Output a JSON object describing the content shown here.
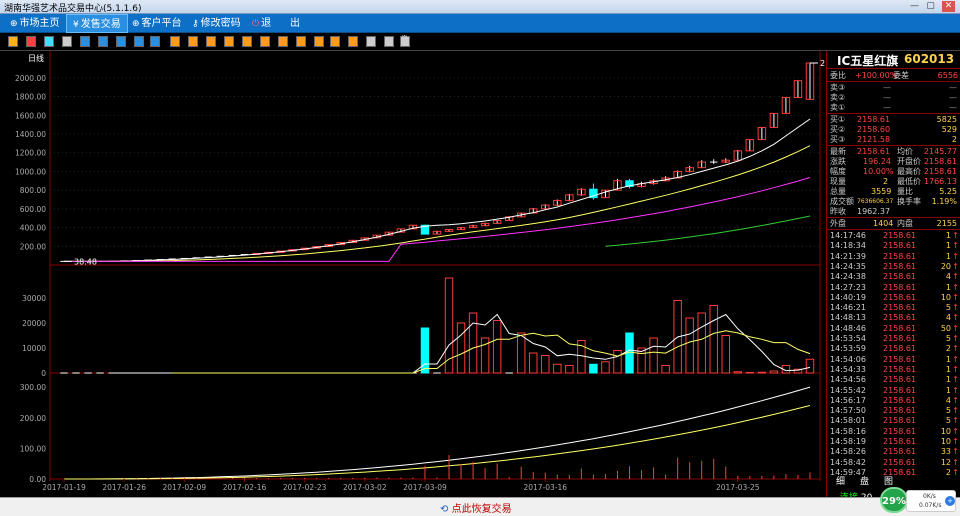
{
  "window": {
    "title": "湖南华强艺术品交易中心(5.1.1.6)",
    "min": "—",
    "max": "▢",
    "close": "✕"
  },
  "menu": {
    "home": "市场主页",
    "sell": "发售交易",
    "client": "客户平台",
    "password": "修改密码",
    "back": "退",
    "exit": "出"
  },
  "chart": {
    "period": "日线",
    "price_labels": [
      "2000.00",
      "1800.00",
      "1600.00",
      "1400.00",
      "1200.00",
      "1000.00",
      "800.00",
      "600.00",
      "400.00",
      "200.00"
    ],
    "vol_labels": [
      "30000",
      "20000",
      "10000",
      "0"
    ],
    "ind_labels": [
      "300.00",
      "200.00",
      "100.00",
      "0.00"
    ],
    "dates": [
      "2017-01-19",
      "2017-01-26",
      "2017-02-09",
      "2017-02-16",
      "2017-02-23",
      "2017-03-02",
      "2017-03-09",
      "2017-03-16",
      "2017-03-25"
    ],
    "max_price": "2158.61",
    "min_price": "38.48"
  },
  "chart_data": {
    "type": "candlestick",
    "candles": [
      {
        "o": 38.48,
        "h": 40,
        "l": 38,
        "c": 38.48
      },
      {
        "o": 38.48,
        "h": 40,
        "l": 38,
        "c": 38.48
      },
      {
        "o": 38.48,
        "h": 40,
        "l": 38,
        "c": 38.48
      },
      {
        "o": 38.48,
        "h": 40,
        "l": 38,
        "c": 38.48
      },
      {
        "o": 38.48,
        "h": 40,
        "l": 38,
        "c": 38.48
      },
      {
        "o": 40,
        "h": 44,
        "l": 40,
        "c": 44
      },
      {
        "o": 44,
        "h": 48,
        "l": 44,
        "c": 48
      },
      {
        "o": 48,
        "h": 53,
        "l": 48,
        "c": 53
      },
      {
        "o": 53,
        "h": 58,
        "l": 53,
        "c": 58
      },
      {
        "o": 58,
        "h": 64,
        "l": 58,
        "c": 64
      },
      {
        "o": 64,
        "h": 70,
        "l": 64,
        "c": 70
      },
      {
        "o": 70,
        "h": 77,
        "l": 70,
        "c": 77
      },
      {
        "o": 77,
        "h": 85,
        "l": 77,
        "c": 85
      },
      {
        "o": 85,
        "h": 93,
        "l": 85,
        "c": 93
      },
      {
        "o": 93,
        "h": 102,
        "l": 93,
        "c": 102
      },
      {
        "o": 102,
        "h": 112,
        "l": 102,
        "c": 112
      },
      {
        "o": 112,
        "h": 123,
        "l": 112,
        "c": 123
      },
      {
        "o": 123,
        "h": 135,
        "l": 123,
        "c": 135
      },
      {
        "o": 135,
        "h": 149,
        "l": 135,
        "c": 149
      },
      {
        "o": 149,
        "h": 164,
        "l": 149,
        "c": 164
      },
      {
        "o": 164,
        "h": 180,
        "l": 164,
        "c": 180
      },
      {
        "o": 180,
        "h": 198,
        "l": 180,
        "c": 198
      },
      {
        "o": 198,
        "h": 218,
        "l": 198,
        "c": 218
      },
      {
        "o": 218,
        "h": 240,
        "l": 218,
        "c": 240
      },
      {
        "o": 240,
        "h": 264,
        "l": 240,
        "c": 264
      },
      {
        "o": 264,
        "h": 290,
        "l": 264,
        "c": 290
      },
      {
        "o": 290,
        "h": 319,
        "l": 290,
        "c": 319
      },
      {
        "o": 319,
        "h": 351,
        "l": 319,
        "c": 351
      },
      {
        "o": 351,
        "h": 386,
        "l": 351,
        "c": 386
      },
      {
        "o": 386,
        "h": 425,
        "l": 386,
        "c": 425
      },
      {
        "o": 425,
        "h": 430,
        "l": 330,
        "c": 330
      },
      {
        "o": 330,
        "h": 365,
        "l": 330,
        "c": 360
      },
      {
        "o": 360,
        "h": 385,
        "l": 355,
        "c": 380
      },
      {
        "o": 380,
        "h": 405,
        "l": 375,
        "c": 400
      },
      {
        "o": 400,
        "h": 430,
        "l": 395,
        "c": 420
      },
      {
        "o": 420,
        "h": 450,
        "l": 415,
        "c": 445
      },
      {
        "o": 445,
        "h": 480,
        "l": 440,
        "c": 475
      },
      {
        "o": 475,
        "h": 520,
        "l": 470,
        "c": 515
      },
      {
        "o": 515,
        "h": 560,
        "l": 510,
        "c": 555
      },
      {
        "o": 555,
        "h": 610,
        "l": 550,
        "c": 600
      },
      {
        "o": 600,
        "h": 650,
        "l": 590,
        "c": 640
      },
      {
        "o": 640,
        "h": 700,
        "l": 630,
        "c": 690
      },
      {
        "o": 690,
        "h": 760,
        "l": 680,
        "c": 750
      },
      {
        "o": 750,
        "h": 820,
        "l": 740,
        "c": 810
      },
      {
        "o": 810,
        "h": 870,
        "l": 700,
        "c": 720
      },
      {
        "o": 720,
        "h": 800,
        "l": 720,
        "c": 800
      },
      {
        "o": 800,
        "h": 920,
        "l": 800,
        "c": 900
      },
      {
        "o": 900,
        "h": 920,
        "l": 820,
        "c": 840
      },
      {
        "o": 840,
        "h": 890,
        "l": 830,
        "c": 870
      },
      {
        "o": 870,
        "h": 915,
        "l": 860,
        "c": 900
      },
      {
        "o": 900,
        "h": 950,
        "l": 895,
        "c": 930
      },
      {
        "o": 930,
        "h": 1010,
        "l": 925,
        "c": 1000
      },
      {
        "o": 1000,
        "h": 1060,
        "l": 990,
        "c": 1040
      },
      {
        "o": 1040,
        "h": 1120,
        "l": 1035,
        "c": 1100
      },
      {
        "o": 1100,
        "h": 1130,
        "l": 1080,
        "c": 1100
      },
      {
        "o": 1100,
        "h": 1140,
        "l": 1090,
        "c": 1120
      },
      {
        "o": 1120,
        "h": 1230,
        "l": 1120,
        "c": 1220
      },
      {
        "o": 1220,
        "h": 1340,
        "l": 1220,
        "c": 1340
      },
      {
        "o": 1340,
        "h": 1470,
        "l": 1340,
        "c": 1470
      },
      {
        "o": 1470,
        "h": 1620,
        "l": 1470,
        "c": 1620
      },
      {
        "o": 1620,
        "h": 1790,
        "l": 1620,
        "c": 1790
      },
      {
        "o": 1790,
        "h": 1970,
        "l": 1790,
        "c": 1970
      },
      {
        "o": 1770,
        "h": 2158.61,
        "l": 1770,
        "c": 2158.61
      }
    ],
    "volume": [
      0,
      0,
      0,
      0,
      0,
      0,
      0,
      0,
      0,
      0,
      0,
      0,
      0,
      0,
      0,
      0,
      0,
      0,
      0,
      0,
      0,
      0,
      0,
      0,
      0,
      0,
      0,
      0,
      0,
      0,
      18000,
      0,
      38000,
      20000,
      24000,
      14000,
      21000,
      0,
      16000,
      8000,
      7000,
      3500,
      3000,
      13000,
      3500,
      4500,
      9000,
      16000,
      10000,
      14000,
      3000,
      29000,
      22000,
      24000,
      27000,
      15000,
      500,
      200,
      300,
      800,
      3000,
      1500,
      5500
    ],
    "ma": {
      "ma5": [
        38,
        38,
        38,
        39,
        40,
        42,
        45,
        49,
        54,
        59,
        65,
        72,
        79,
        87,
        96,
        106,
        117,
        129,
        142,
        156,
        171,
        188,
        206,
        226,
        248,
        272,
        298,
        327,
        359,
        393,
        415,
        425,
        430,
        440,
        455,
        470,
        490,
        510,
        535,
        560,
        590,
        620,
        660,
        700,
        740,
        780,
        815,
        845,
        870,
        890,
        910,
        935,
        965,
        1000,
        1035,
        1070,
        1110,
        1160,
        1220,
        1290,
        1380,
        1470,
        1560
      ],
      "ma10": [
        38,
        38,
        38,
        38,
        38,
        39,
        40,
        42,
        44,
        47,
        50,
        54,
        59,
        64,
        70,
        76,
        83,
        91,
        99,
        108,
        118,
        129,
        141,
        154,
        168,
        183,
        199,
        216,
        235,
        256,
        277,
        298,
        318,
        337,
        355,
        372,
        389,
        406,
        423,
        442,
        462,
        484,
        508,
        534,
        562,
        592,
        622,
        652,
        683,
        714,
        745,
        778,
        812,
        848,
        884,
        922,
        962,
        1004,
        1050,
        1100,
        1154,
        1212,
        1275
      ],
      "ma20": [
        38,
        38,
        38,
        38,
        38,
        38,
        38,
        38,
        38,
        38,
        38,
        38,
        38,
        38,
        38,
        38,
        38,
        38,
        38,
        38,
        38,
        38,
        38,
        38,
        38,
        38,
        38,
        38,
        220,
        232,
        244,
        256,
        268,
        280,
        293,
        306,
        319,
        333,
        347,
        362,
        377,
        393,
        410,
        427,
        445,
        464,
        484,
        505,
        526,
        548,
        571,
        595,
        620,
        646,
        673,
        701,
        730,
        761,
        793,
        826,
        861,
        897,
        935
      ],
      "ma30": [
        null,
        null,
        null,
        null,
        null,
        null,
        null,
        null,
        null,
        null,
        null,
        null,
        null,
        null,
        null,
        null,
        null,
        null,
        null,
        null,
        null,
        null,
        null,
        null,
        null,
        null,
        null,
        null,
        null,
        null,
        null,
        null,
        null,
        null,
        null,
        null,
        null,
        null,
        null,
        null,
        null,
        null,
        null,
        null,
        null,
        200,
        212,
        224,
        237,
        251,
        266,
        282,
        299,
        317,
        336,
        356,
        377,
        399,
        422,
        446,
        471,
        497,
        524
      ]
    },
    "ylim": [
      0,
      2158.61
    ],
    "vol_ylim": [
      0,
      40000
    ],
    "ind_ylim": [
      0,
      320
    ]
  },
  "quote": {
    "name": "IC五星红旗",
    "code": "602013",
    "webi_label": "委比",
    "webi_val": "+100.00%",
    "wecha_label": "委差",
    "wecha_val": "6556",
    "sell3": "卖③",
    "sell2": "卖②",
    "sell1": "卖①",
    "dash": "—",
    "buy1_label": "买①",
    "buy1_price": "2158.61",
    "buy1_vol": "5825",
    "buy2_label": "买②",
    "buy2_price": "2158.60",
    "buy2_vol": "529",
    "buy3_label": "买③",
    "buy3_price": "2121.58",
    "buy3_vol": "2",
    "latest_label": "最新",
    "latest_val": "2158.61",
    "avg_label": "均价",
    "avg_val": "2145.77",
    "change_label": "涨跌",
    "change_val": "196.24",
    "open_label": "开盘价",
    "open_val": "2158.61",
    "range_label": "幅度",
    "range_val": "10.00%",
    "high_label": "最高价",
    "high_val": "2158.61",
    "now_label": "现量",
    "now_val": "2",
    "low_label": "最低价",
    "low_val": "1766.13",
    "total_label": "总量",
    "total_val": "3559",
    "ratio_label": "量比",
    "ratio_val": "5.25",
    "amount_label": "成交额",
    "amount_val": "7636606.37",
    "turnover_label": "换手率",
    "turnover_val": "1.19%",
    "prevclose_label": "昨收",
    "prevclose_val": "1962.37",
    "outer_label": "外盘",
    "outer_val": "1404",
    "inner_label": "内盘",
    "inner_val": "2155"
  },
  "ticks": [
    {
      "t": "14:17:46",
      "p": "2158.61",
      "v": "1"
    },
    {
      "t": "14:18:34",
      "p": "2158.61",
      "v": "1"
    },
    {
      "t": "14:21:39",
      "p": "2158.61",
      "v": "1"
    },
    {
      "t": "14:24:35",
      "p": "2158.61",
      "v": "20"
    },
    {
      "t": "14:24:38",
      "p": "2158.61",
      "v": "4"
    },
    {
      "t": "14:27:23",
      "p": "2158.61",
      "v": "1"
    },
    {
      "t": "14:40:19",
      "p": "2158.61",
      "v": "10"
    },
    {
      "t": "14:46:21",
      "p": "2158.61",
      "v": "5"
    },
    {
      "t": "14:48:13",
      "p": "2158.61",
      "v": "4"
    },
    {
      "t": "14:48:46",
      "p": "2158.61",
      "v": "50"
    },
    {
      "t": "14:53:54",
      "p": "2158.61",
      "v": "5"
    },
    {
      "t": "14:53:59",
      "p": "2158.61",
      "v": "2"
    },
    {
      "t": "14:54:06",
      "p": "2158.61",
      "v": "1"
    },
    {
      "t": "14:54:33",
      "p": "2158.61",
      "v": "1"
    },
    {
      "t": "14:54:56",
      "p": "2158.61",
      "v": "1"
    },
    {
      "t": "14:55:42",
      "p": "2158.61",
      "v": "1"
    },
    {
      "t": "14:56:17",
      "p": "2158.61",
      "v": "4"
    },
    {
      "t": "14:57:50",
      "p": "2158.61",
      "v": "5"
    },
    {
      "t": "14:58:01",
      "p": "2158.61",
      "v": "5"
    },
    {
      "t": "14:58:16",
      "p": "2158.61",
      "v": "10"
    },
    {
      "t": "14:58:19",
      "p": "2158.61",
      "v": "10"
    },
    {
      "t": "14:58:26",
      "p": "2158.61",
      "v": "33"
    },
    {
      "t": "14:58:42",
      "p": "2158.61",
      "v": "12"
    },
    {
      "t": "14:59:47",
      "p": "2158.61",
      "v": "2"
    }
  ],
  "tabs": {
    "detail": "细",
    "pan": "盘",
    "chart": "图"
  },
  "status": {
    "resume": "点此恢复交易",
    "connected": "连接",
    "cut": "20",
    "percent": "29%",
    "net1": "0K/s",
    "net2": "0.07K/s"
  },
  "colors": {
    "up": "#ff3b3b",
    "down": "#00ffff",
    "ma5": "#ffffff",
    "ma10": "#ffff66",
    "ma20": "#ff33ff",
    "ma30": "#33cc33",
    "axis": "#8b0000"
  }
}
